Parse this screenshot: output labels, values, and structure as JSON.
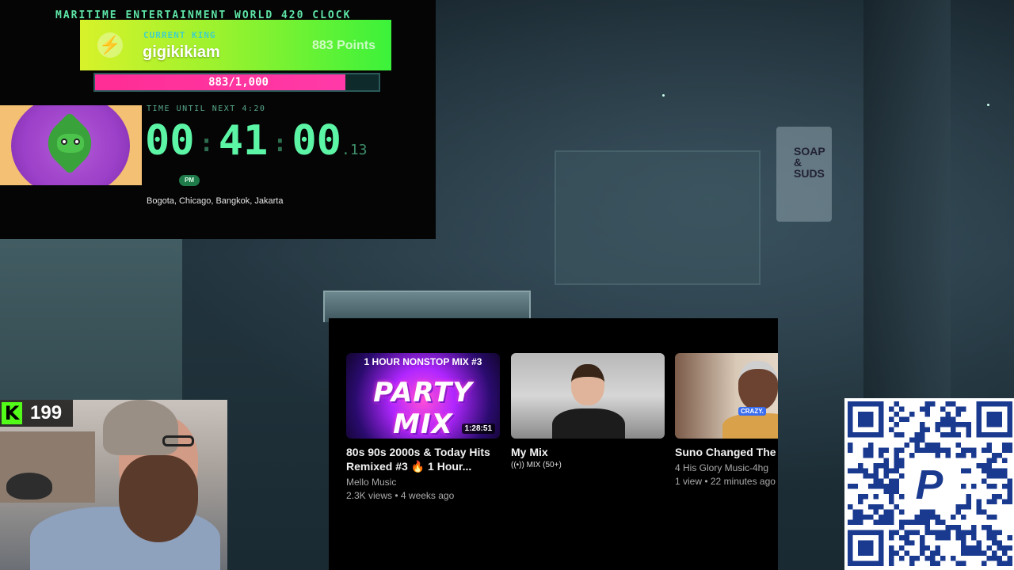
{
  "clock": {
    "title": "MARITIME ENTERTAINMENT WORLD 420 CLOCK",
    "king_label": "CURRENT KING",
    "king_name": "gigikikiam",
    "king_points": "883 Points",
    "progress_text": "883/1,000",
    "progress_fraction": 0.883,
    "next_label": "TIME UNTIL NEXT 4:20",
    "hours": "00",
    "minutes": "41",
    "seconds": "00",
    "sep1": ":",
    "sep2": ":",
    "centiseconds": ".13",
    "ampm": "PM",
    "cities": "Bogota, Chicago, Bangkok, Jakarta",
    "accent_color": "#5cf5a6"
  },
  "youtube": {
    "cards": [
      {
        "thumb_top_text": "1 HOUR NONSTOP MIX #3",
        "thumb_big_text": "PARTY MIX",
        "duration": "1:28:51",
        "title": "80s 90s 2000s & Today Hits Remixed #3 🔥 1 Hour...",
        "channel": "Mello Music",
        "stats": "2.3K views • 4 weeks ago"
      },
      {
        "title": "My Mix",
        "mix_label": "((•)) MIX (50+)"
      },
      {
        "badge": "CRAZY.",
        "title": "Suno Changed The Game",
        "channel": "4 His Glory Music-4hg",
        "stats": "1 view • 22 minutes ago"
      }
    ]
  },
  "kick": {
    "logo": "K",
    "viewer_count": "199",
    "brand_color": "#53fc18"
  },
  "scene": {
    "sign_text": "SOAP & SUDS"
  },
  "qr": {
    "logo": "P",
    "brand_color": "#1a3a8f"
  }
}
